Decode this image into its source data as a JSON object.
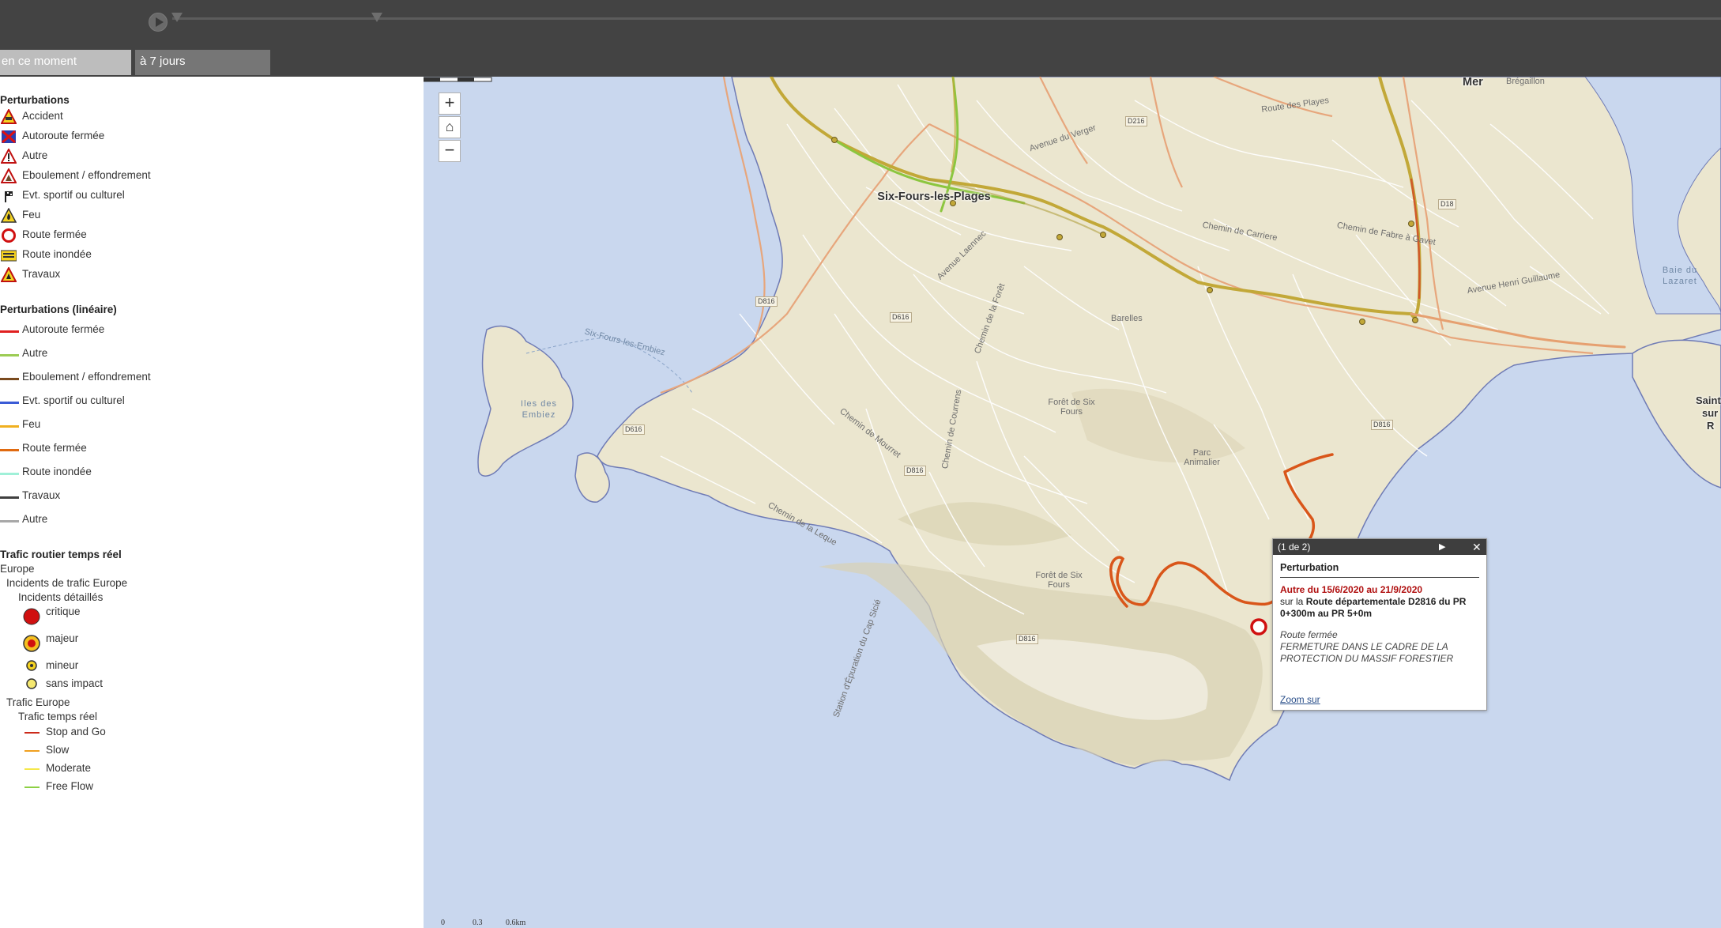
{
  "tabs": {
    "now": "en ce moment",
    "seven_days": "à 7 jours"
  },
  "legend": {
    "perturbations": {
      "title": "Perturbations",
      "items": [
        "Accident",
        "Autoroute fermée",
        "Autre",
        "Eboulement / effondrement",
        "Evt. sportif ou culturel",
        "Feu",
        "Route fermée",
        "Route inondée",
        "Travaux"
      ]
    },
    "lineaire": {
      "title": "Perturbations (linéaire)",
      "items": [
        {
          "label": "Autoroute fermée",
          "color": "#e02020"
        },
        {
          "label": "Autre",
          "color": "#9ccc54"
        },
        {
          "label": "Eboulement / effondrement",
          "color": "#7a4a1e"
        },
        {
          "label": "Evt. sportif ou culturel",
          "color": "#3a5bd6"
        },
        {
          "label": "Feu",
          "color": "#f0b020"
        },
        {
          "label": "Route fermée",
          "color": "#e06a10"
        },
        {
          "label": "Route inondée",
          "color": "#a0f0d8"
        },
        {
          "label": "Travaux",
          "color": "#404040"
        },
        {
          "label": "Autre",
          "color": "#a8a8a8"
        }
      ]
    },
    "trafic": {
      "title": "Trafic routier temps réel",
      "europe": "Europe",
      "incidents": "Incidents de trafic Europe",
      "detailed": "Incidents détaillés",
      "levels": [
        "critique",
        "majeur",
        "mineur",
        "sans impact"
      ],
      "trafic_europe": "Trafic Europe",
      "temps_reel": "Trafic temps réel",
      "flows": [
        {
          "label": "Stop and Go",
          "color": "#cc2a1a"
        },
        {
          "label": "Slow",
          "color": "#f0a020"
        },
        {
          "label": "Moderate",
          "color": "#f5e84a"
        },
        {
          "label": "Free Flow",
          "color": "#8cd044"
        }
      ]
    }
  },
  "map": {
    "zoom_in": "+",
    "home": "⌂",
    "zoom_out": "−",
    "places": {
      "town": "Six-Fours-les-Plages",
      "mer": "Mer",
      "saint": "Saint",
      "sur": "sur",
      "r": "R",
      "iles": "Iles des Embiez",
      "baie": "Baie du Lazaret",
      "foret1": "Forêt de Six Fours",
      "foret2": "Forêt de Six Fours",
      "parc": "Parc Animalier",
      "barelles": "Barelles",
      "chemin_carriere": "Chemin de Carriere",
      "fabre": "Chemin de Fabre à Gavet",
      "verger": "Avenue du Verger",
      "laennec": "Avenue Laennec",
      "foret_chemin": "Chemin de la Forêt",
      "mourret": "Chemin de Mourret",
      "courrens": "Chemin de Courrens",
      "leque": "Chemin de la Leque",
      "cap_sicie": "Station d'Épuration du Cap Sicié",
      "embiez_route": "Six-Fours-les-Embiez",
      "guillaume": "Avenue Henri Guillaume",
      "bregaillon": "Brégaillon",
      "route_des_playes": "Route des Playes"
    },
    "shields": [
      "D216",
      "D816",
      "D816",
      "D816",
      "D816",
      "D616",
      "D616",
      "D18"
    ],
    "scale": [
      "0",
      "0.3",
      "0.6km"
    ]
  },
  "popup": {
    "count": "(1 de 2)",
    "next": "▶",
    "close": "✕",
    "title": "Perturbation",
    "dates": "Autre du 15/6/2020 au 21/9/2020",
    "desc_prefix": "sur la ",
    "desc_road": "Route départementale D2816",
    "desc_suffix": " du PR 0+300m  au PR 5+0m",
    "type": "Route fermée",
    "detail": "FERMETURE DANS LE CADRE DE LA PROTECTION DU MASSIF FORESTIER",
    "zoom": "Zoom sur"
  },
  "colors": {
    "water": "#c9d7ee",
    "land": "#ebe6cf",
    "closed_road": "#d9561a",
    "traffic_green": "#8cc63f",
    "traffic_olive": "#b9a63a"
  }
}
